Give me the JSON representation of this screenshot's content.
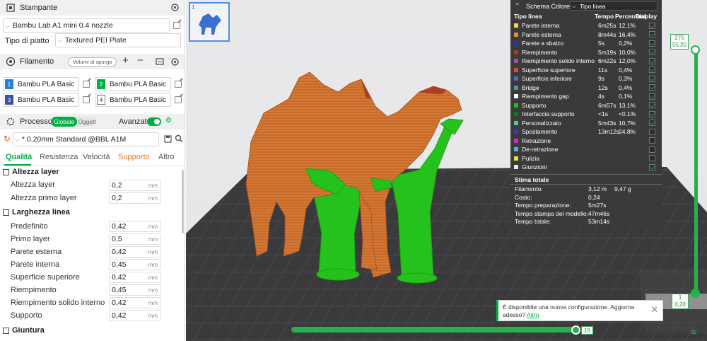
{
  "printer": {
    "header": "Stampante",
    "name": "Bambu Lab A1 mini 0.4 nozzle",
    "plate_label": "Tipo di piatto",
    "plate": "Textured PEI Plate"
  },
  "filament": {
    "header": "Filamento",
    "purge": "Volumi di spurgo",
    "slots": [
      {
        "n": "1",
        "name": "Bambu PLA Basic",
        "color": "#2a7fd4"
      },
      {
        "n": "2",
        "name": "Bambu PLA Basic",
        "color": "#00ae42"
      },
      {
        "n": "3",
        "name": "Bambu PLA Basic",
        "color": "#3d4fa0"
      },
      {
        "n": "4",
        "name": "Bambu PLA Basic",
        "color": "#ffffff"
      }
    ]
  },
  "process": {
    "header": "Processo",
    "toggle_a": "Globale",
    "toggle_b": "Oggetti",
    "advanced": "Avanzate",
    "preset": "* 0.20mm Standard @BBL A1M",
    "tabs": [
      "Qualità",
      "Resistenza",
      "Velocità",
      "Supporto",
      "Altro"
    ],
    "groups": [
      {
        "title": "Altezza layer"
      },
      {
        "title": "Larghezza linea"
      },
      {
        "title": "Giuntura"
      }
    ],
    "params": [
      {
        "label": "Altezza layer",
        "value": "0,2",
        "unit": "mm"
      },
      {
        "label": "Altezza primo layer",
        "value": "0,2",
        "unit": "mm"
      },
      {
        "label": "Predefinito",
        "value": "0,42",
        "unit": "mm"
      },
      {
        "label": "Primo layer",
        "value": "0,5",
        "unit": "mm"
      },
      {
        "label": "Parete esterna",
        "value": "0,42",
        "unit": "mm"
      },
      {
        "label": "Parete interna",
        "value": "0,45",
        "unit": "mm"
      },
      {
        "label": "Superficie superiore",
        "value": "0,42",
        "unit": "mm"
      },
      {
        "label": "Riempimento",
        "value": "0,45",
        "unit": "mm"
      },
      {
        "label": "Riempimento solido interno",
        "value": "0,42",
        "unit": "mm"
      },
      {
        "label": "Supporto",
        "value": "0,42",
        "unit": "mm"
      }
    ]
  },
  "legend": {
    "title": "Schema Colore",
    "mode": "Tipo linea",
    "col_type": "Tipo linea",
    "col_time": "Tempo",
    "col_pct": "Percentuale",
    "col_disp": "Display",
    "rows": [
      {
        "name": "Parete interna",
        "time": "6m25s",
        "pct": "12,1%",
        "color": "#f5d45c",
        "on": true
      },
      {
        "name": "Parete esterna",
        "time": "8m44s",
        "pct": "16,4%",
        "color": "#e58b3d",
        "on": true
      },
      {
        "name": "Parete a sbalzo",
        "time": "5s",
        "pct": "0,2%",
        "color": "#1d35c4",
        "on": true
      },
      {
        "name": "Riempimento",
        "time": "5m19s",
        "pct": "10,0%",
        "color": "#a33b2f",
        "on": true
      },
      {
        "name": "Riempimento solido interno",
        "time": "6m22s",
        "pct": "12,0%",
        "color": "#9b52b6",
        "on": true
      },
      {
        "name": "Superficie superiore",
        "time": "11s",
        "pct": "0,4%",
        "color": "#e0463d",
        "on": true
      },
      {
        "name": "Superficie inferiore",
        "time": "9s",
        "pct": "0,3%",
        "color": "#3d73c7",
        "on": true
      },
      {
        "name": "Bridge",
        "time": "12s",
        "pct": "0,4%",
        "color": "#5591b3",
        "on": true
      },
      {
        "name": "Riempimento gap",
        "time": "4s",
        "pct": "0,1%",
        "color": "#ffffff",
        "on": true
      },
      {
        "name": "Supporto",
        "time": "6m57s",
        "pct": "13,1%",
        "color": "#14c21a",
        "on": true
      },
      {
        "name": "Interfaccia supporto",
        "time": "<1s",
        "pct": "<0.1%",
        "color": "#14752c",
        "on": true
      },
      {
        "name": "Personalizzato",
        "time": "5m43s",
        "pct": "10,7%",
        "color": "#52c79a",
        "on": true
      },
      {
        "name": "Spostamento",
        "time": "13m12s",
        "pct": "24,8%",
        "color": "#3341b5",
        "on": false
      },
      {
        "name": "Retrazione",
        "time": "",
        "pct": "",
        "color": "#cc2fcf",
        "on": false
      },
      {
        "name": "De-retrazione",
        "time": "",
        "pct": "",
        "color": "#4fb3e0",
        "on": false
      },
      {
        "name": "Pulizia",
        "time": "",
        "pct": "",
        "color": "#f2e03a",
        "on": false
      },
      {
        "name": "Giunzioni",
        "time": "",
        "pct": "",
        "color": "#e9e9e9",
        "on": true
      }
    ]
  },
  "stats": {
    "title": "Stima totale",
    "rows": [
      {
        "label": "Filamento:",
        "v1": "3,12 m",
        "v2": "9,47 g"
      },
      {
        "label": "Costo:",
        "v1": "0,24",
        "v2": ""
      },
      {
        "label": "Tempo preparazione:",
        "v1": "5m27s",
        "v2": ""
      },
      {
        "label": "Tempo stampa del modello:",
        "v1": "47m46s",
        "v2": ""
      },
      {
        "label": "Tempo totale:",
        "v1": "53m14s",
        "v2": ""
      }
    ]
  },
  "layer_slider": {
    "top_layer": "276",
    "top_height": "55,20",
    "bottom_layer": "1",
    "bottom_height": "0,20"
  },
  "move_slider": {
    "value": "19"
  },
  "notice": {
    "text": "È disponibile una nuova configurazione. Aggiorna adesso?",
    "link": "Altro"
  },
  "thumb": {
    "index": "1"
  }
}
